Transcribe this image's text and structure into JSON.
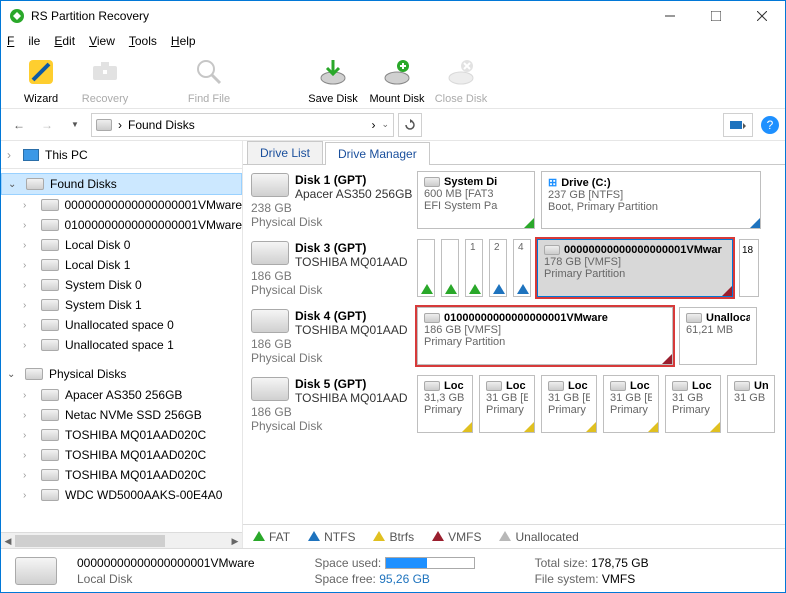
{
  "window": {
    "title": "RS Partition Recovery"
  },
  "menu": {
    "file": "File",
    "edit": "Edit",
    "view": "View",
    "tools": "Tools",
    "help": "Help"
  },
  "toolbar": {
    "wizard": "Wizard",
    "recovery": "Recovery",
    "findfile": "Find File",
    "savedisk": "Save Disk",
    "mountdisk": "Mount Disk",
    "closedisk": "Close Disk"
  },
  "nav": {
    "crumb": "Found Disks",
    "sep": "›"
  },
  "sidebar": {
    "thispc": "This PC",
    "found": "Found Disks",
    "found_items": [
      "00000000000000000001VMware",
      "01000000000000000001VMware",
      "Local Disk 0",
      "Local Disk 1",
      "System Disk 0",
      "System Disk 1",
      "Unallocated space 0",
      "Unallocated space 1"
    ],
    "physical": "Physical Disks",
    "phys_items": [
      "Apacer AS350 256GB",
      "Netac NVMe SSD 256GB",
      "TOSHIBA MQ01AAD020C",
      "TOSHIBA MQ01AAD020C",
      "TOSHIBA MQ01AAD020C",
      "WDC WD5000AAKS-00E4A0"
    ]
  },
  "tabs": {
    "drivelist": "Drive List",
    "drivemanager": "Drive Manager"
  },
  "disks": [
    {
      "title": "Disk 1 (GPT)",
      "model": "Apacer AS350 256GB",
      "size": "238 GB",
      "type": "Physical Disk",
      "parts": [
        {
          "name": "System Di",
          "line1": "600 MB [FAT3",
          "line2": "EFI System Pa",
          "corner": "green",
          "mini": true
        },
        {
          "name": "Drive (C:)",
          "line1": "237 GB [NTFS]",
          "line2": "Boot, Primary Partition",
          "corner": "blue",
          "mini": true,
          "winic": true
        }
      ]
    },
    {
      "title": "Disk 3 (GPT)",
      "model": "TOSHIBA MQ01AAD",
      "size": "186 GB",
      "type": "Physical Disk",
      "thin": [
        "green",
        "green",
        "green",
        "blue",
        "blue"
      ],
      "thin_nums": [
        "",
        "",
        "1",
        "2",
        "4"
      ],
      "sel": {
        "name": "00000000000000000001VMwar",
        "line1a": "178 GB ",
        "fs": "[VMFS]",
        "line2": "Primary Partition"
      },
      "tail": "18"
    },
    {
      "title": "Disk 4 (GPT)",
      "model": "TOSHIBA MQ01AAD",
      "size": "186 GB",
      "type": "Physical Disk",
      "big": {
        "name": "01000000000000000001VMware",
        "line1a": "186 GB ",
        "fs": "[VMFS]",
        "line2": "Primary Partition"
      },
      "unalloc": {
        "name": "Unallocat",
        "line1": "61,21 MB"
      }
    },
    {
      "title": "Disk 5 (GPT)",
      "model": "TOSHIBA MQ01AAD",
      "size": "186 GB",
      "type": "Physical Disk",
      "locs": [
        {
          "name": "Loc",
          "line1": "31,3 GB",
          "line2": "Primary"
        },
        {
          "name": "Loc",
          "line1": "31 GB [E",
          "line2": "Primary"
        },
        {
          "name": "Loc",
          "line1": "31 GB [E",
          "line2": "Primary"
        },
        {
          "name": "Loc",
          "line1": "31 GB [E",
          "line2": "Primary"
        },
        {
          "name": "Loc",
          "line1": "31 GB",
          "line2": "Primary"
        }
      ],
      "unal": {
        "name": "Unal",
        "line1": "31 GB"
      }
    }
  ],
  "legend": {
    "fat": "FAT",
    "ntfs": "NTFS",
    "btrfs": "Btrfs",
    "vmfs": "VMFS",
    "unalloc": "Unallocated"
  },
  "status": {
    "name": "00000000000000000001VMware",
    "type": "Local Disk",
    "used_label": "Space used:",
    "free_label": "Space free:",
    "free_val": "95,26 GB",
    "total_label": "Total size:",
    "total_val": "178,75 GB",
    "fs_label": "File system:",
    "fs_val": "VMFS",
    "used_pct": 47
  }
}
